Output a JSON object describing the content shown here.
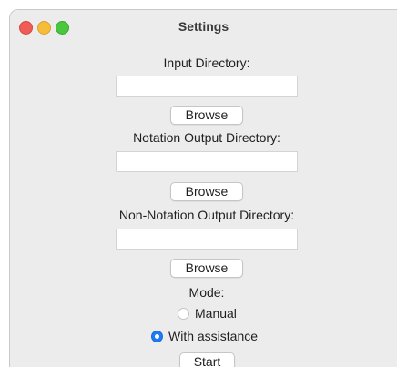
{
  "window": {
    "title": "Settings"
  },
  "form": {
    "input_dir_label": "Input Directory:",
    "input_dir_value": "",
    "browse1_label": "Browse",
    "notation_dir_label": "Notation Output Directory:",
    "notation_dir_value": "",
    "browse2_label": "Browse",
    "nonnotation_dir_label": "Non-Notation Output Directory:",
    "nonnotation_dir_value": "",
    "browse3_label": "Browse",
    "mode_label": "Mode:",
    "mode_options": [
      "Manual",
      "With assistance"
    ],
    "mode_selected": "With assistance",
    "start_label": "Start"
  },
  "colors": {
    "traffic_close": "#ee5d57",
    "traffic_minimize": "#f5bd3a",
    "traffic_maximize": "#4cc63f",
    "radio_selected": "#1f7bf5",
    "window_bg": "#ececec"
  }
}
